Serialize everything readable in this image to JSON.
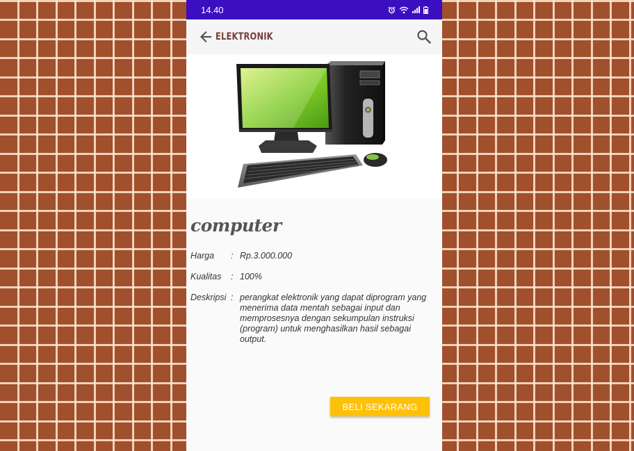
{
  "status_bar": {
    "time": "14.40",
    "icons": [
      "alarm-icon",
      "wifi-icon",
      "signal-icon",
      "battery-icon"
    ]
  },
  "app_bar": {
    "title": "ELEKTRONIK",
    "back_icon": "arrow-left-icon",
    "search_icon": "search-icon"
  },
  "product": {
    "image": "desktop-computer-illustration",
    "name": "computer",
    "price_label": "Harga",
    "price_value": "Rp.3.000.000",
    "quality_label": "Kualitas",
    "quality_value": "100%",
    "description_label": "Deskripsi",
    "description_value": "perangkat elektronik yang dapat diprogram yang menerima data mentah sebagai input dan memprosesnya dengan sekumpulan instruksi (program) untuk menghasilkan hasil sebagai output.",
    "separator": ":"
  },
  "actions": {
    "buy_label": "BELI SEKARANG"
  },
  "colors": {
    "status_bar": "#3b0ec0",
    "title": "#7a3d3d",
    "buy_button": "#ffc107",
    "background_tile": "#a0502c"
  }
}
